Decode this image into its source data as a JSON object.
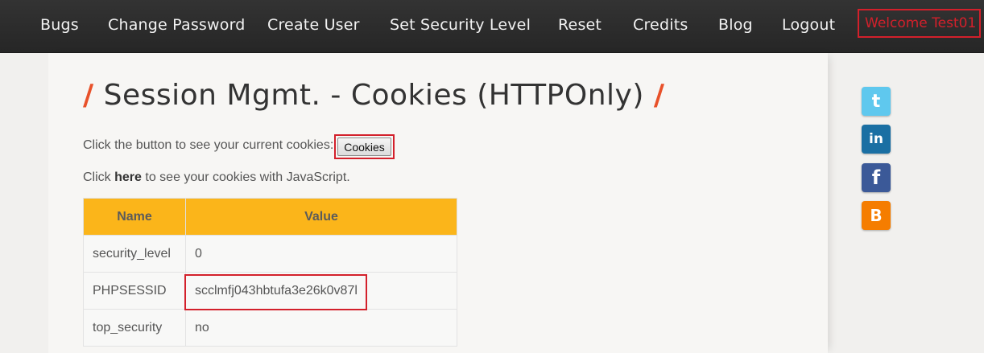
{
  "nav": {
    "items": [
      "Bugs",
      "Change Password",
      "Create User",
      "Set Security Level",
      "Reset",
      "Credits",
      "Blog",
      "Logout"
    ],
    "welcome": "Welcome Test01"
  },
  "page": {
    "title": "Session Mgmt. - Cookies (HTTPOnly)",
    "slash": "/",
    "instruction": "Click the button to see your current cookies:",
    "cookies_button": "Cookies",
    "js_prefix": "Click",
    "js_link": "here",
    "js_suffix": "to see your cookies with JavaScript."
  },
  "table": {
    "headers": [
      "Name",
      "Value"
    ],
    "rows": [
      {
        "name": "security_level",
        "value": "0"
      },
      {
        "name": "PHPSESSID",
        "value": "scclmfj043hbtufa3e26k0v87l"
      },
      {
        "name": "top_security",
        "value": "no"
      }
    ]
  },
  "social": [
    {
      "icon": "twitter-icon",
      "glyph": "t",
      "color": "#5fc8ee"
    },
    {
      "icon": "linkedin-icon",
      "glyph": "in",
      "color": "#1a6fa3"
    },
    {
      "icon": "facebook-icon",
      "glyph": "f",
      "color": "#3b5998"
    },
    {
      "icon": "blogger-icon",
      "glyph": "B",
      "color": "#f57d00"
    }
  ],
  "colors": {
    "accent_orange": "#e8512a",
    "table_header": "#fbb51a",
    "highlight_red": "#d3202b"
  }
}
